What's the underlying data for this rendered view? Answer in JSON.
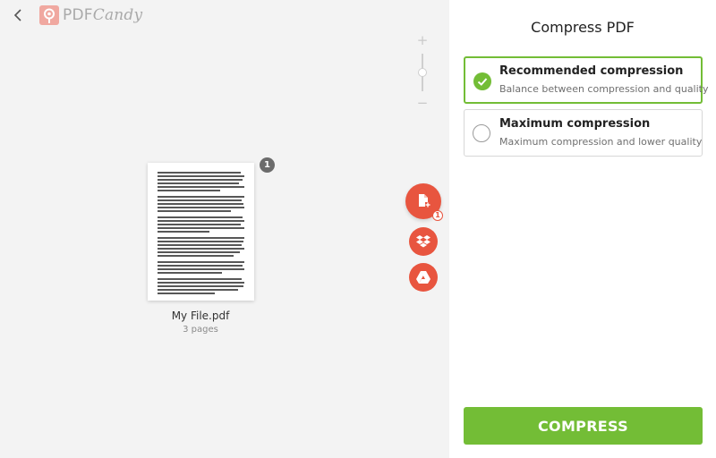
{
  "app": {
    "brand_left": "PDF",
    "brand_right": "Candy",
    "back_icon": "chevron-left-icon"
  },
  "zoom": {
    "plus_label": "+",
    "minus_label": "−",
    "level": 0.6
  },
  "document": {
    "page_badge": "1",
    "file_name": "My File.pdf",
    "pages_label": "3 pages"
  },
  "actions": {
    "add_file_icon": "add-file-icon",
    "add_file_count": "1",
    "dropbox_icon": "dropbox-icon",
    "drive_icon": "google-drive-icon"
  },
  "panel": {
    "title": "Compress PDF",
    "options": [
      {
        "title": "Recommended compression",
        "description": "Balance between compression and quality",
        "selected": true
      },
      {
        "title": "Maximum compression",
        "description": "Maximum compression and lower quality",
        "selected": false
      }
    ],
    "button_label": "COMPRESS"
  },
  "colors": {
    "accent_green": "#73bd36",
    "accent_red": "#e8553f",
    "brand_pink": "#f0a8a0"
  }
}
